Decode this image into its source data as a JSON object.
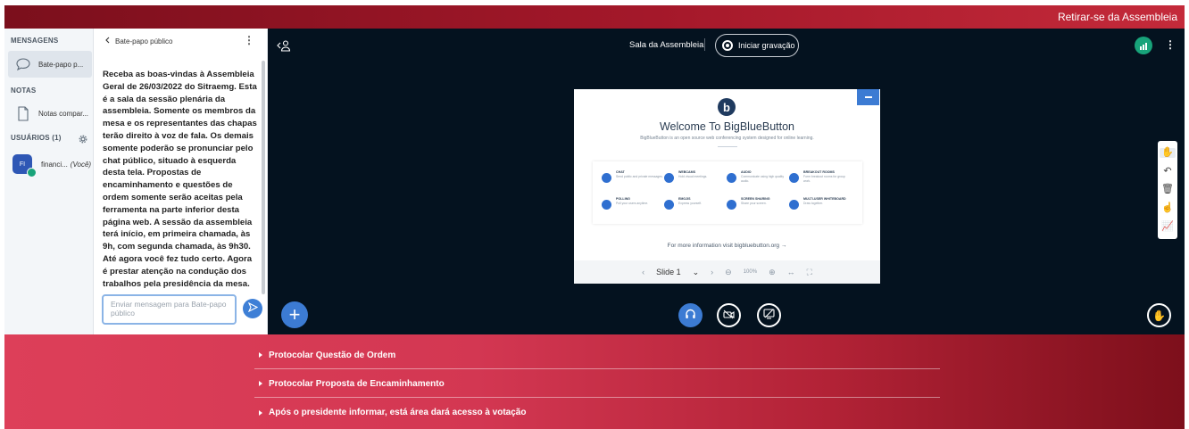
{
  "topbar": {
    "leave_label": "Retirar-se da Assembleia"
  },
  "sidebar": {
    "messages_title": "MENSAGENS",
    "public_chat_label": "Bate-papo p...",
    "notes_title": "NOTAS",
    "shared_notes_label": "Notas compar...",
    "users_title": "USUÁRIOS (1)",
    "user": {
      "initials": "FI",
      "name": "financi...",
      "you_tag": "(Você)"
    }
  },
  "chat": {
    "back_label": "Bate-papo público",
    "welcome_message": "Receba as boas-vindas à Assembleia Geral de 26/03/2022 do Sitraemg. Esta é a sala da sessão plenária da assembleia. Somente os membros da mesa e os representantes das chapas terão direito à voz de fala. Os demais somente poderão se pronunciar pelo chat público, situado à esquerda desta tela. Propostas de encaminhamento e questões de ordem somente serão aceitas pela ferramenta na parte inferior desta página web. A sessão da assembleia terá início, em primeira chamada, às 9h, com segunda chamada, às 9h30. Até agora você fez tudo certo. Agora é prestar atenção na condução dos trabalhos pela presidência da mesa.",
    "input_placeholder": "Enviar mensagem para Bate-papo público"
  },
  "main": {
    "room_title": "Sala da Assembleia",
    "record_label": "Iniciar gravação"
  },
  "slide": {
    "logo_letter": "b",
    "title": "Welcome To BigBlueButton",
    "subtitle": "BigBlueButton is an open source web conferencing system designed for online learning.",
    "features": [
      {
        "title": "CHAT",
        "desc": "Send public and private messages."
      },
      {
        "title": "WEBCAMS",
        "desc": "Hold visual meetings."
      },
      {
        "title": "AUDIO",
        "desc": "Communicate using high quality audio."
      },
      {
        "title": "BREAKOUT ROOMS",
        "desc": "Form breakout rooms for group work."
      },
      {
        "title": "POLLING",
        "desc": "Poll your users anytime."
      },
      {
        "title": "EMOJIS",
        "desc": "Express yourself."
      },
      {
        "title": "SCREEN SHARING",
        "desc": "Share your screen."
      },
      {
        "title": "MULTI-USER WHITEBOARD",
        "desc": "Draw together."
      }
    ],
    "more_info": "For more information visit bigbluebutton.org →",
    "slide_label": "Slide 1",
    "zoom_label": "100%"
  },
  "footer": {
    "items": [
      "Protocolar Questão de Ordem",
      "Protocolar Proposta de Encaminhamento",
      "Após o presidente informar, está área dará acesso à votação"
    ]
  },
  "colors": {
    "accent": "#3c7bd3",
    "main_bg": "#04121f",
    "footer_red": "#d33752",
    "topbar_red": "#a4182a"
  }
}
